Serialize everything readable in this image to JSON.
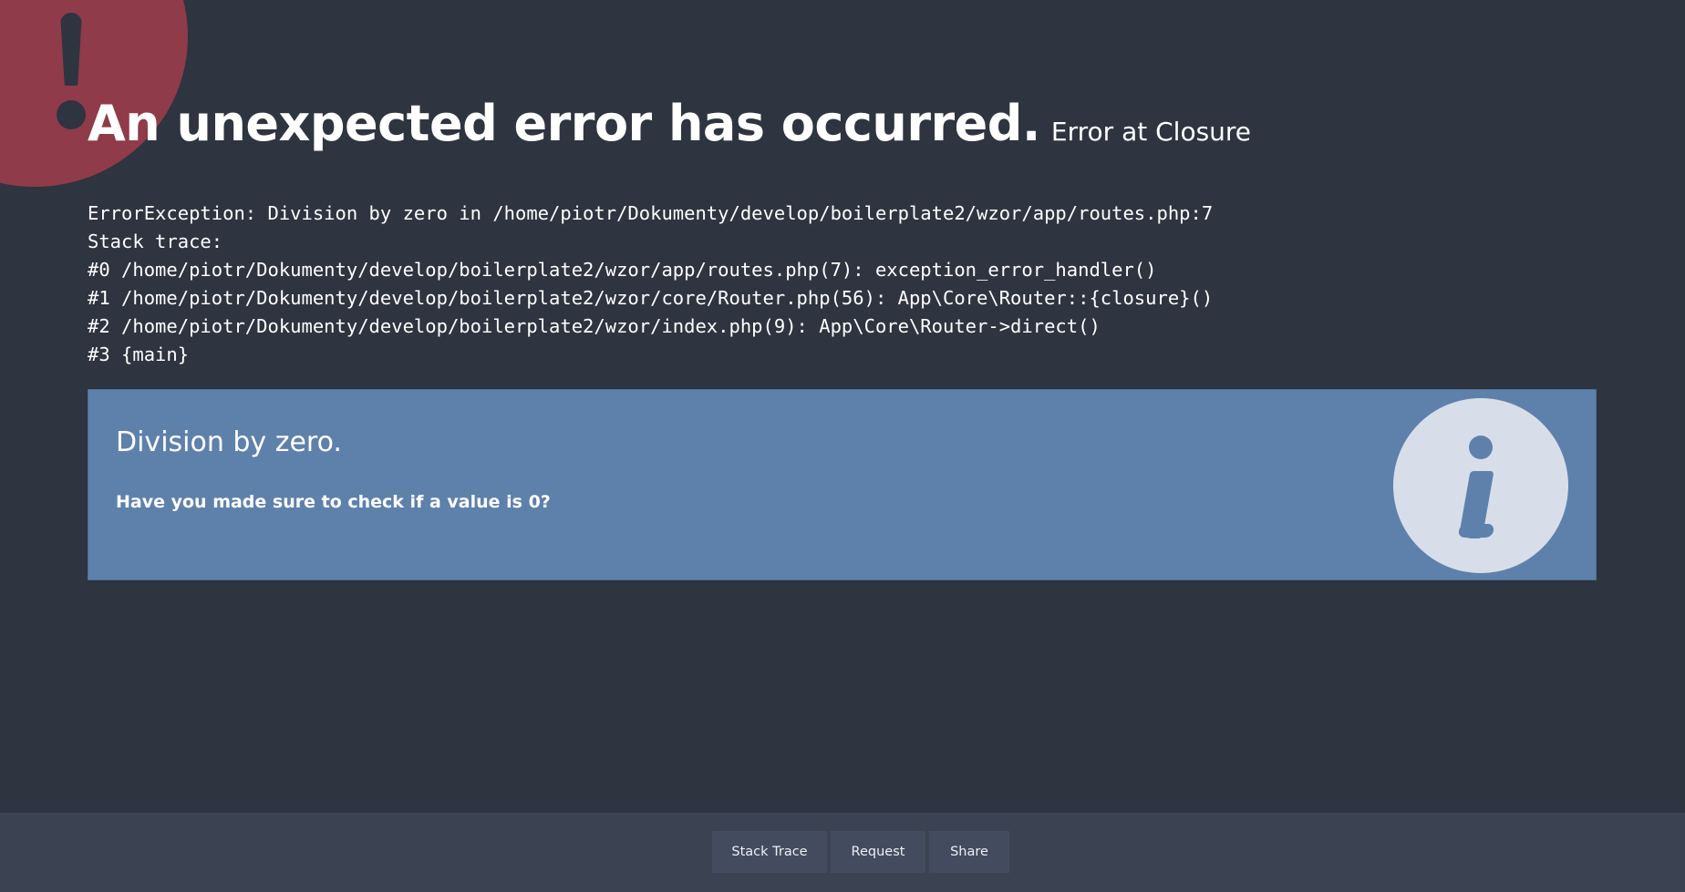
{
  "header": {
    "title": "An unexpected error has occurred.",
    "subtitle": "Error at Closure"
  },
  "trace": {
    "lines": [
      "ErrorException: Division by zero in /home/piotr/Dokumenty/develop/boilerplate2/wzor/app/routes.php:7",
      "Stack trace:",
      "#0 /home/piotr/Dokumenty/develop/boilerplate2/wzor/app/routes.php(7): exception_error_handler()",
      "#1 /home/piotr/Dokumenty/develop/boilerplate2/wzor/core/Router.php(56): App\\Core\\Router::{closure}()",
      "#2 /home/piotr/Dokumenty/develop/boilerplate2/wzor/index.php(9): App\\Core\\Router->direct()",
      "#3 {main}"
    ]
  },
  "info": {
    "title": "Division by zero.",
    "text": "Have you made sure to check if a value is 0?",
    "icon": "info-icon"
  },
  "alert": {
    "icon": "exclamation-icon",
    "color": "#8f3b4a"
  },
  "footer": {
    "tabs": [
      {
        "label": "Stack Trace"
      },
      {
        "label": "Request"
      },
      {
        "label": "Share"
      }
    ]
  },
  "colors": {
    "background": "#2e3440",
    "info_box": "#5e81ac",
    "footer": "#3b4252",
    "tab": "#434c5e"
  }
}
